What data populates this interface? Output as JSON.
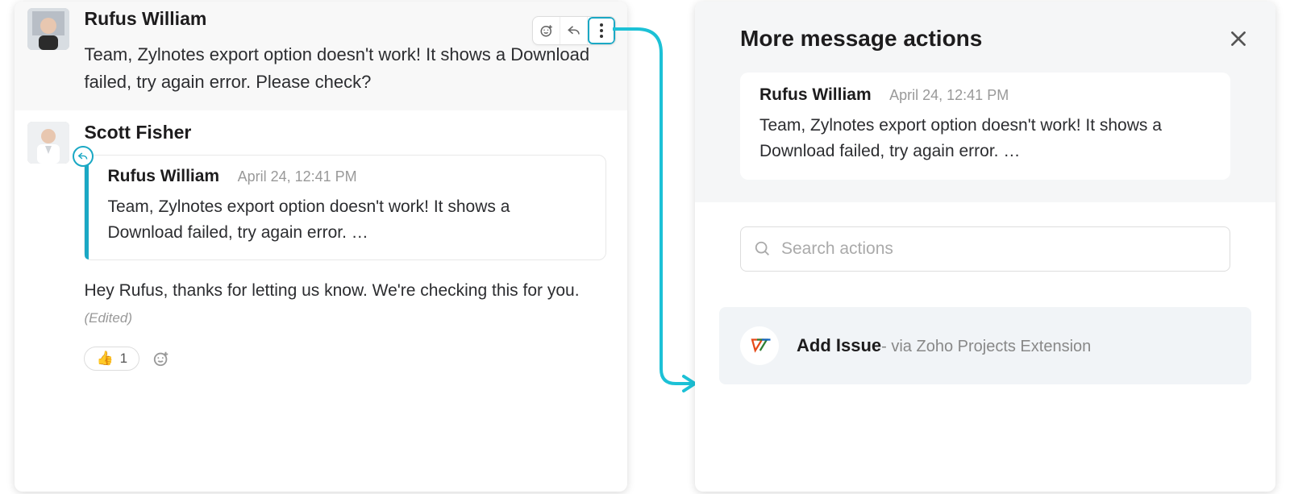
{
  "chat": {
    "msg1": {
      "author": "Rufus William",
      "text": "Team, Zylnotes export option doesn't work! It shows a Download failed, try again error. Please check?"
    },
    "msg2": {
      "author": "Scott Fisher",
      "quote": {
        "author": "Rufus William",
        "timestamp": "April 24, 12:41 PM",
        "text": "Team, Zylnotes export option doesn't work! It shows a Download failed, try again error. …"
      },
      "reply": "Hey Rufus, thanks for letting us know. We're checking this for you. ",
      "edited_label": "(Edited)",
      "reactions": {
        "thumbsup_emoji": "👍",
        "thumbsup_count": "1"
      }
    }
  },
  "dialog": {
    "title": "More message actions",
    "quote": {
      "author": "Rufus William",
      "timestamp": "April 24, 12:41 PM",
      "text": "Team, Zylnotes export option doesn't work! It shows a Download failed, try again error. …"
    },
    "search_placeholder": "Search actions",
    "action": {
      "label": "Add Issue",
      "sub": "- via Zoho Projects Extension"
    }
  }
}
